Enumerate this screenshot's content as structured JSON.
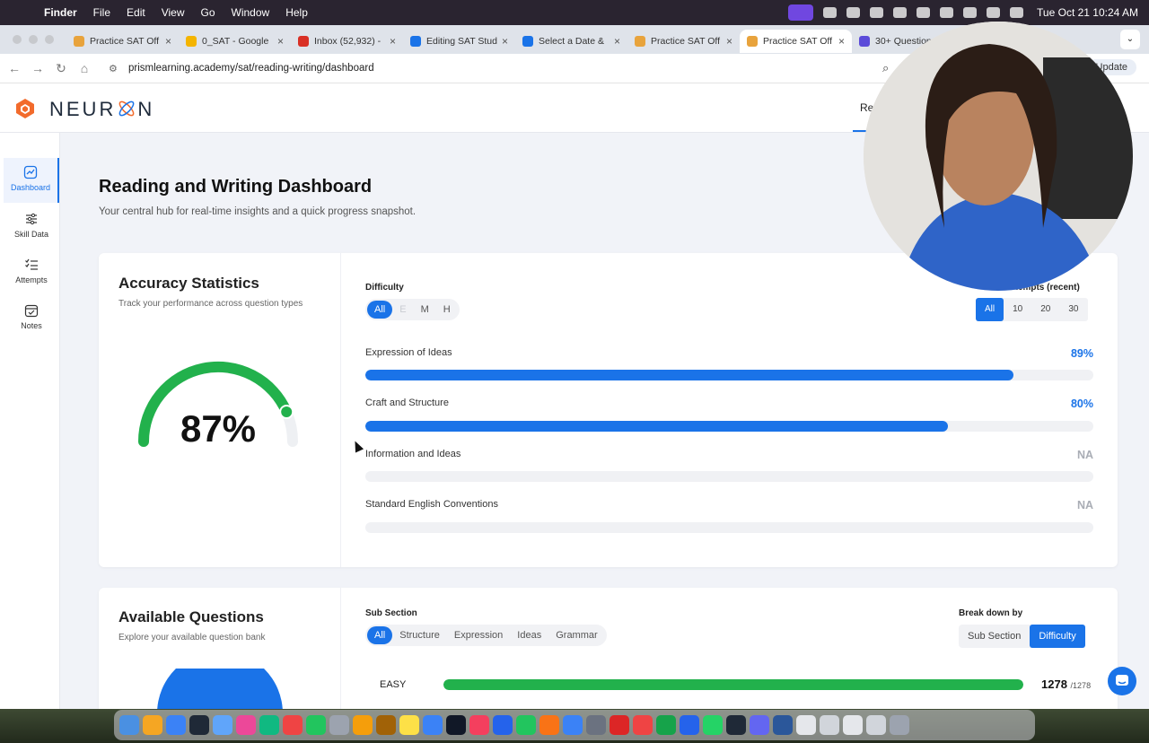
{
  "menubar": {
    "app_name": "Finder",
    "menus": [
      "File",
      "Edit",
      "View",
      "Go",
      "Window",
      "Help"
    ],
    "clock": "Tue Oct 21  10:24 AM"
  },
  "tabs": [
    {
      "label": "Practice SAT Off",
      "color": "#e8a33c"
    },
    {
      "label": "0_SAT - Google",
      "color": "#f4b400"
    },
    {
      "label": "Inbox (52,932) -",
      "color": "#d93025"
    },
    {
      "label": "Editing SAT Stud",
      "color": "#1a73e8"
    },
    {
      "label": "Select a Date &",
      "color": "#1a73e8"
    },
    {
      "label": "Practice SAT Off",
      "color": "#e8a33c"
    },
    {
      "label": "Practice SAT Off",
      "color": "#e8a33c"
    },
    {
      "label": "30+ Questions| I",
      "color": "#5b4bd9"
    }
  ],
  "address": {
    "url": "prismlearning.academy/sat/reading-writing/dashboard",
    "update_label": "Update"
  },
  "site": {
    "logo_text": "NEUR",
    "logo_text_end": "N",
    "header_link": "Re"
  },
  "sidebar": {
    "items": [
      {
        "label": "Dashboard",
        "icon": "chart-line-icon"
      },
      {
        "label": "Skill Data",
        "icon": "sliders-icon"
      },
      {
        "label": "Attempts",
        "icon": "checklist-icon"
      },
      {
        "label": "Notes",
        "icon": "calendar-check-icon"
      }
    ]
  },
  "dashboard": {
    "title": "Reading and Writing Dashboard",
    "subtitle": "Your central hub for real-time insights and a quick progress snapshot."
  },
  "accuracy": {
    "title": "Accuracy Statistics",
    "subtitle": "Track your performance across question types",
    "overall_pct": "87%",
    "overall_value": 0.87,
    "difficulty_label": "Difficulty",
    "difficulty_options": [
      "All",
      "E",
      "M",
      "H"
    ],
    "attempts_label": "Attempts (recent)",
    "attempts_options": [
      "All",
      "10",
      "20",
      "30"
    ],
    "skills": [
      {
        "label": "Expression of Ideas",
        "pct": "89%",
        "value": 0.89
      },
      {
        "label": "Craft and Structure",
        "pct": "80%",
        "value": 0.8
      },
      {
        "label": "Information and Ideas",
        "pct": "NA",
        "value": 0
      },
      {
        "label": "Standard English Conventions",
        "pct": "NA",
        "value": 0
      }
    ]
  },
  "available": {
    "title": "Available Questions",
    "subtitle": "Explore your available question bank",
    "subsection_label": "Sub Section",
    "subsection_options": [
      "All",
      "Structure",
      "Expression",
      "Ideas",
      "Grammar"
    ],
    "breakdown_label": "Break down by",
    "breakdown_options": [
      "Sub Section",
      "Difficulty"
    ],
    "rows": [
      {
        "label": "EASY",
        "count": "1278",
        "total": "/1278",
        "value": 1.0
      }
    ]
  },
  "colors": {
    "accent": "#1a73e8",
    "gauge_green": "#22b14c",
    "page_bg": "#f1f3f8"
  }
}
